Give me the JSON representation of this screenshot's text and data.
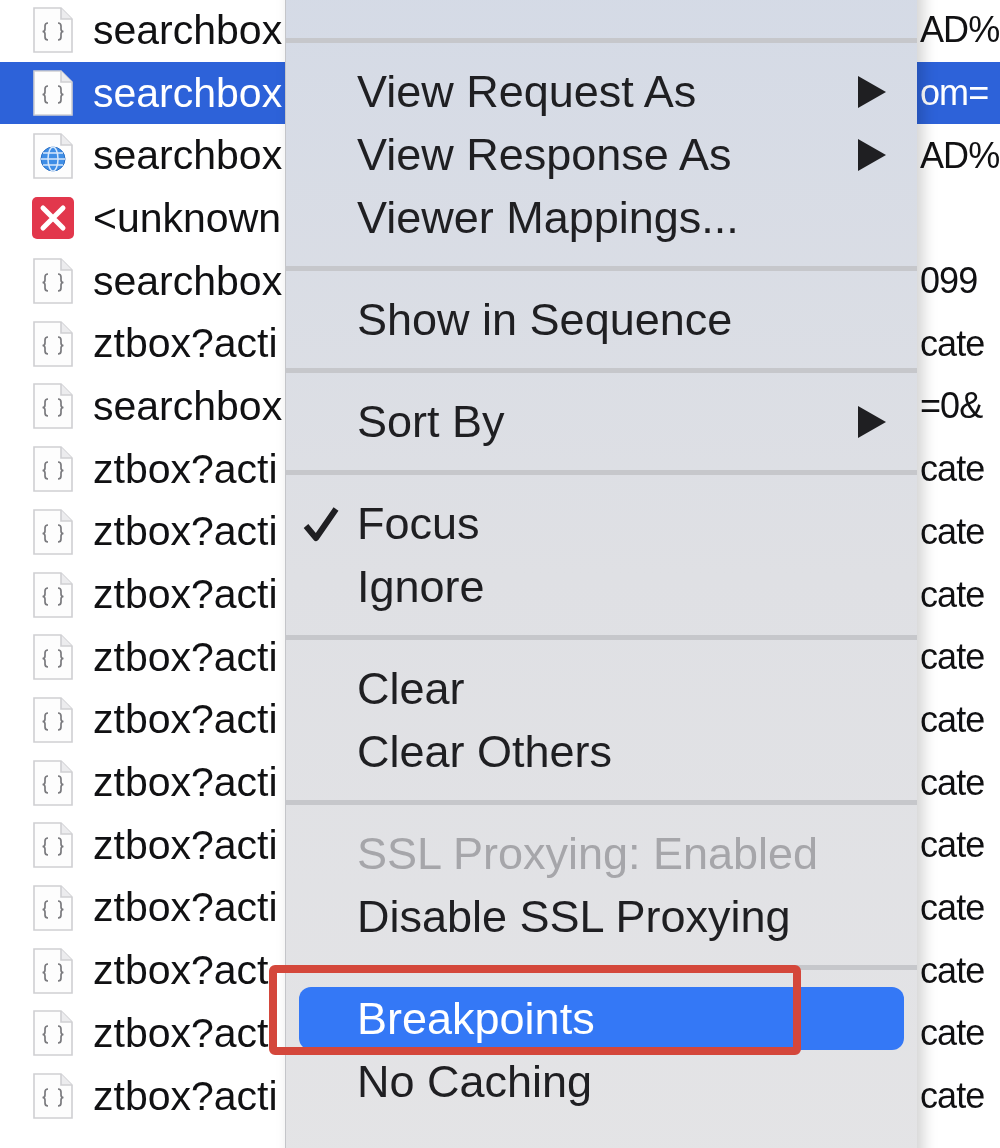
{
  "request_list": {
    "rows": [
      {
        "kind": "json",
        "name": "searchbox",
        "detail": "AD%",
        "selected": false
      },
      {
        "kind": "json",
        "name": "searchbox",
        "detail": "om=",
        "selected": true
      },
      {
        "kind": "web",
        "name": "searchbox",
        "detail": "AD%",
        "selected": false
      },
      {
        "kind": "error",
        "name": "<unknown",
        "selected": false
      },
      {
        "kind": "json",
        "name": "searchbox",
        "detail": "099",
        "selected": false
      },
      {
        "kind": "json",
        "name": "ztbox?acti",
        "detail": "cate",
        "selected": false
      },
      {
        "kind": "json",
        "name": "searchbox",
        "detail": "=0&",
        "selected": false
      },
      {
        "kind": "json",
        "name": "ztbox?acti",
        "detail": "cate",
        "selected": false
      },
      {
        "kind": "json",
        "name": "ztbox?acti",
        "detail": "cate",
        "selected": false
      },
      {
        "kind": "json",
        "name": "ztbox?acti",
        "detail": "cate",
        "selected": false
      },
      {
        "kind": "json",
        "name": "ztbox?acti",
        "detail": "cate",
        "selected": false
      },
      {
        "kind": "json",
        "name": "ztbox?acti",
        "detail": "cate",
        "selected": false
      },
      {
        "kind": "json",
        "name": "ztbox?acti",
        "detail": "cate",
        "selected": false
      },
      {
        "kind": "json",
        "name": "ztbox?acti",
        "detail": "cate",
        "selected": false
      },
      {
        "kind": "json",
        "name": "ztbox?acti",
        "detail": "cate",
        "selected": false
      },
      {
        "kind": "json",
        "name": "ztbox?act",
        "detail": "cate",
        "selected": false
      },
      {
        "kind": "json",
        "name": "ztbox?act",
        "detail": "cate",
        "selected": false
      },
      {
        "kind": "json",
        "name": "ztbox?acti",
        "detail": "cate",
        "selected": false
      }
    ]
  },
  "context_menu": {
    "groups": [
      [
        {
          "label": "View Request As",
          "checked": false,
          "submenu": true,
          "disabled": false,
          "selected": false,
          "outlined": false
        },
        {
          "label": "View Response As",
          "checked": false,
          "submenu": true,
          "disabled": false,
          "selected": false,
          "outlined": false
        },
        {
          "label": "Viewer Mappings...",
          "checked": false,
          "submenu": false,
          "disabled": false,
          "selected": false,
          "outlined": false
        }
      ],
      [
        {
          "label": "Show in Sequence",
          "checked": false,
          "submenu": false,
          "disabled": false,
          "selected": false,
          "outlined": false
        }
      ],
      [
        {
          "label": "Sort By",
          "checked": false,
          "submenu": true,
          "disabled": false,
          "selected": false,
          "outlined": false
        }
      ],
      [
        {
          "label": "Focus",
          "checked": true,
          "submenu": false,
          "disabled": false,
          "selected": false,
          "outlined": false
        },
        {
          "label": "Ignore",
          "checked": false,
          "submenu": false,
          "disabled": false,
          "selected": false,
          "outlined": false
        }
      ],
      [
        {
          "label": "Clear",
          "checked": false,
          "submenu": false,
          "disabled": false,
          "selected": false,
          "outlined": false
        },
        {
          "label": "Clear Others",
          "checked": false,
          "submenu": false,
          "disabled": false,
          "selected": false,
          "outlined": false
        }
      ],
      [
        {
          "label": "SSL Proxying: Enabled",
          "checked": false,
          "submenu": false,
          "disabled": true,
          "selected": false,
          "outlined": false
        },
        {
          "label": "Disable SSL Proxying",
          "checked": false,
          "submenu": false,
          "disabled": false,
          "selected": false,
          "outlined": false
        }
      ],
      [
        {
          "label": "Breakpoints",
          "checked": false,
          "submenu": false,
          "disabled": false,
          "selected": true,
          "outlined": true
        },
        {
          "label": "No Caching",
          "checked": false,
          "submenu": false,
          "disabled": false,
          "selected": false,
          "outlined": false
        }
      ]
    ]
  }
}
